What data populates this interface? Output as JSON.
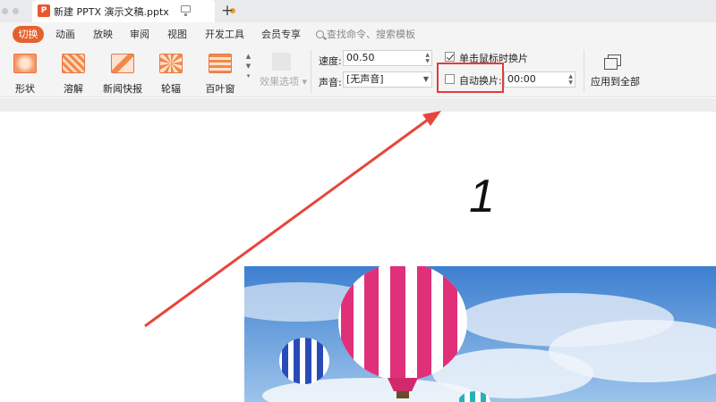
{
  "titlebar": {
    "tab_logo": "P",
    "doc_title": "新建 PPTX 演示文稿.pptx",
    "new_tab": "+"
  },
  "menu": {
    "active": "切换",
    "items": [
      "动画",
      "放映",
      "审阅",
      "视图",
      "开发工具",
      "会员专享"
    ],
    "search_placeholder": "查找命令、搜索模板"
  },
  "ribbon": {
    "effects": [
      "形状",
      "溶解",
      "新闻快报",
      "轮辐",
      "百叶窗"
    ],
    "effect_options": "效果选项",
    "speed_label": "速度:",
    "speed_value": "00.50",
    "sound_label": "声音:",
    "sound_value": "[无声音]",
    "on_click_label": "单击鼠标时换片",
    "on_click_checked": true,
    "auto_label": "自动换片:",
    "auto_checked": false,
    "auto_time": "00:00",
    "apply_all": "应用到全部"
  },
  "slide": {
    "number_annotation": "1"
  },
  "colors": {
    "accent": "#e4612e",
    "highlight_box": "#e03c3c",
    "arrow": "#e8453c"
  }
}
